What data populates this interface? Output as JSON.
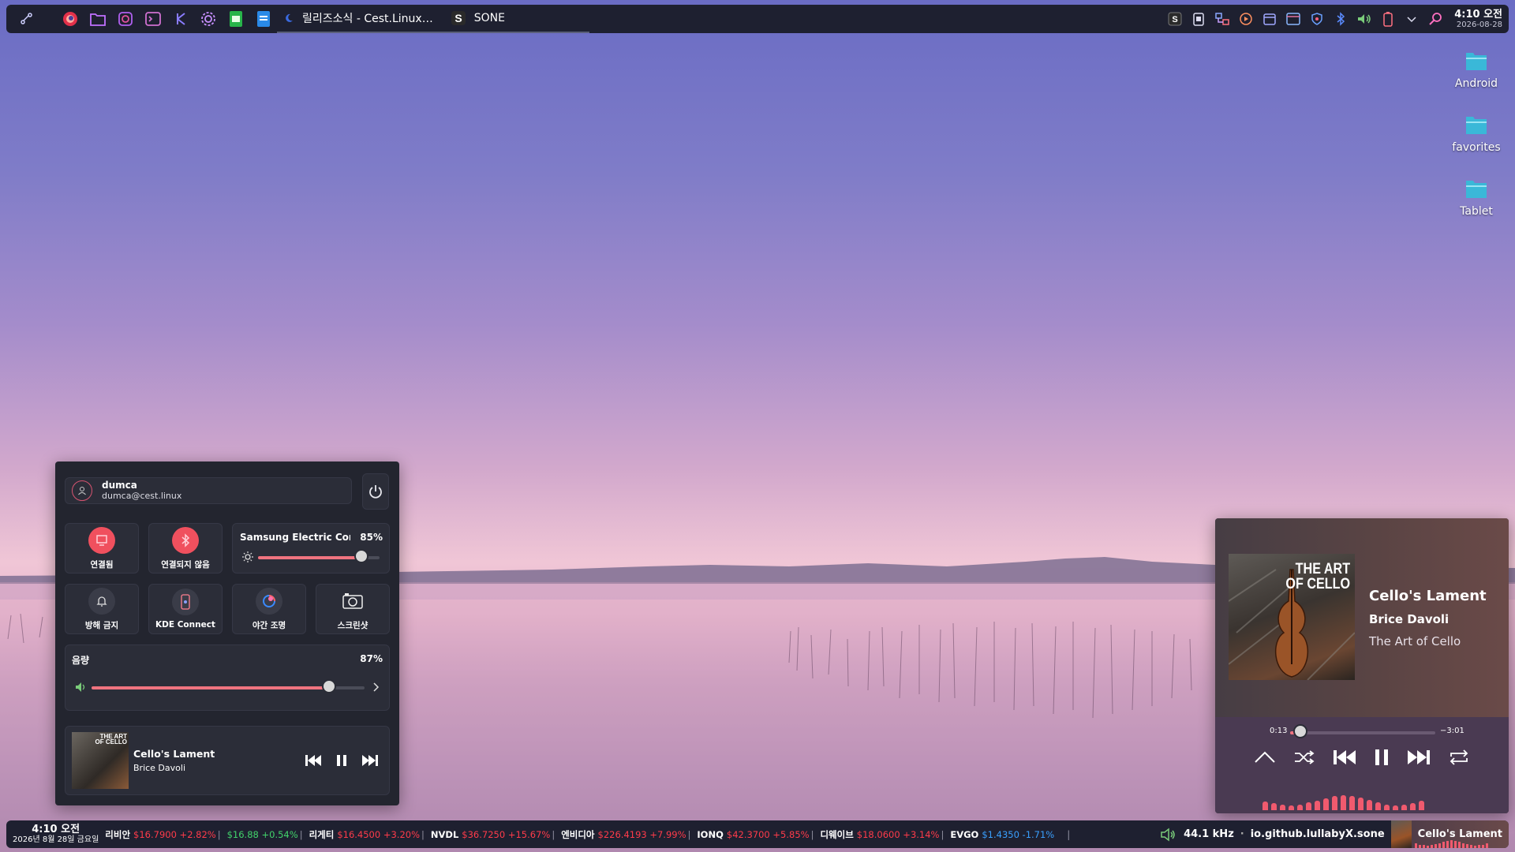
{
  "top_panel": {
    "tasks": [
      {
        "label": "릴리즈소식 - Cest.Linux…",
        "icon": "moon-icon"
      },
      {
        "label": "SONE",
        "icon": "sone-icon"
      }
    ],
    "clock": {
      "time": "4:10 오전",
      "date": "2026-08-28"
    }
  },
  "desktop": {
    "icons": [
      {
        "label": "Android"
      },
      {
        "label": "favorites"
      },
      {
        "label": "Tablet"
      }
    ]
  },
  "control_center": {
    "user": {
      "name": "dumca",
      "email": "dumca@cest.linux"
    },
    "network_label": "연결됨",
    "bluetooth_label": "연결되지 않음",
    "display": {
      "name": "Samsung Electric Compa…",
      "percent": "85%",
      "brightness": 0.85
    },
    "dnd_label": "방해 금지",
    "kde_connect_label": "KDE Connect",
    "night_light_label": "야간 조명",
    "screenshot_label": "스크린샷",
    "volume": {
      "label": "음량",
      "percent": "87%",
      "level": 0.87
    },
    "media": {
      "title": "Cello's Lament",
      "artist": "Brice Davoli",
      "art_text_1": "THE ART",
      "art_text_2": "OF CELLO"
    }
  },
  "player": {
    "title": "Cello's Lament",
    "artist": "Brice Davoli",
    "album": "The Art of Cello",
    "art_text_1": "THE ART",
    "art_text_2": "OF CELLO",
    "elapsed": "0:13",
    "remaining": "−3:01",
    "progress": 0.07,
    "eq_levels": [
      0.45,
      0.3,
      0.2,
      0.15,
      0.2,
      0.35,
      0.5,
      0.7,
      0.9,
      0.95,
      0.85,
      0.75,
      0.55,
      0.35,
      0.2,
      0.15,
      0.2,
      0.3,
      0.5
    ]
  },
  "bottom_panel": {
    "clock": {
      "time": "4:10 오전",
      "date": "2026년 8월 28일 금요일"
    },
    "ticker": [
      {
        "symbol": "리비안",
        "price": "$16.7900",
        "change": "+2.82%",
        "trend": "up"
      },
      {
        "symbol": "",
        "price": "$16.88",
        "change": "+0.54%",
        "trend": "upg"
      },
      {
        "symbol": "리게티",
        "price": "$16.4500",
        "change": "+3.20%",
        "trend": "up"
      },
      {
        "symbol": "NVDL",
        "price": "$36.7250",
        "change": "+15.67%",
        "trend": "up"
      },
      {
        "symbol": "엔비디아",
        "price": "$226.4193",
        "change": "+7.99%",
        "trend": "up"
      },
      {
        "symbol": "IONQ",
        "price": "$42.3700",
        "change": "+5.85%",
        "trend": "up"
      },
      {
        "symbol": "디웨이브",
        "price": "$18.0600",
        "change": "+3.14%",
        "trend": "up"
      },
      {
        "symbol": "EVGO",
        "price": "$1.4350",
        "change": "-1.71%",
        "trend": "dn"
      }
    ],
    "sample_rate": "44.1 kHz",
    "player_id": "io.github.lullabyX.sone",
    "now_playing": "Cello's Lament",
    "separator": "|"
  },
  "colors": {
    "accent": "#f0737f",
    "panel": "#1e2030",
    "up": "#ff3b4a",
    "down": "#3aa0ff"
  }
}
